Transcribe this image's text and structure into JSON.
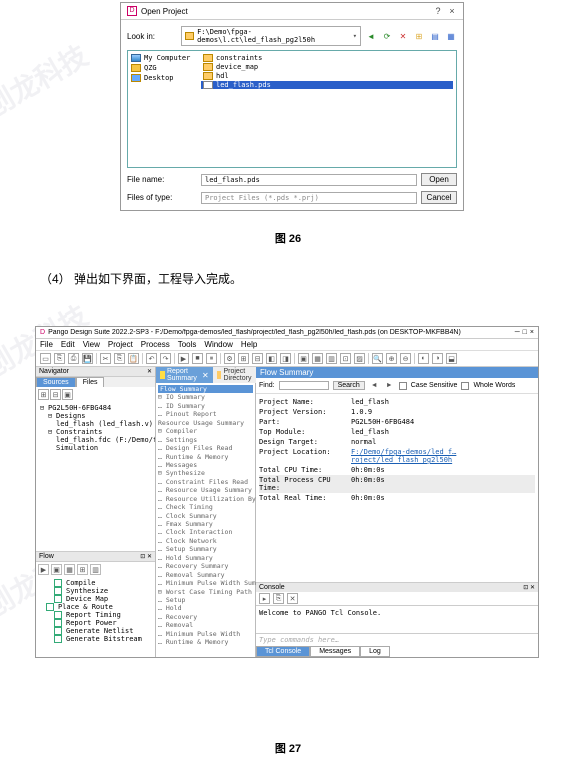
{
  "dialog": {
    "title": "Open Project",
    "help": "?",
    "close": "×",
    "look_in_label": "Look in:",
    "path_folder_icon": "folder",
    "path": "F:\\Demo\\fpga-demos\\l.ct\\led_flash_pg2l50h",
    "side": [
      {
        "icon": "computer",
        "label": "My Computer"
      },
      {
        "icon": "folder-cy",
        "label": "QZG"
      },
      {
        "icon": "folder-desk",
        "label": "Desktop"
      }
    ],
    "files": [
      {
        "icon": "folder",
        "label": "constraints"
      },
      {
        "icon": "folder",
        "label": "device_map"
      },
      {
        "icon": "folder",
        "label": "hdl"
      },
      {
        "icon": "file",
        "label": "led_flash.pds",
        "selected": true
      }
    ],
    "file_name_label": "File name:",
    "file_name": "led_flash.pds",
    "open_btn": "Open",
    "file_type_label": "Files of type:",
    "file_type": "Project Files (*.pds *.prj)",
    "cancel_btn": "Cancel"
  },
  "caption1": "图 26",
  "text1": "（4） 弹出如下界面，工程导入完成。",
  "ide": {
    "title": "Pango Design Suite 2022.2-SP3 - F:/Demo/fpga-demos/led_flash/project/led_flash_pg2l50h/led_flash.pds (on DESKTOP-MKFBB4N)",
    "wbtns": {
      "min": "─",
      "max": "□",
      "close": "×"
    },
    "menu": [
      "File",
      "Edit",
      "View",
      "Project",
      "Process",
      "Tools",
      "Window",
      "Help"
    ],
    "nav": {
      "title": "Navigator",
      "close": "✕",
      "tabs": [
        "Sources",
        "Files"
      ],
      "tree": [
        {
          "exp": "⊟",
          "ind": 0,
          "icon": "▣",
          "text": "PG2L50H-6FBG484"
        },
        {
          "exp": "⊟",
          "ind": 1,
          "icon": "",
          "text": "Designs"
        },
        {
          "exp": "",
          "ind": 2,
          "icon": "V",
          "text": "led_flash (led_flash.v)"
        },
        {
          "exp": "⊟",
          "ind": 1,
          "icon": "",
          "text": "Constraints"
        },
        {
          "exp": "",
          "ind": 2,
          "icon": "",
          "text": "led_flash.fdc (F:/Demo/fpg…"
        },
        {
          "exp": "",
          "ind": 1,
          "icon": "",
          "text": "Simulation"
        }
      ]
    },
    "flow_panel": {
      "title": "Flow",
      "items": [
        {
          "ind": 1,
          "text": "Compile"
        },
        {
          "ind": 1,
          "text": "Synthesize"
        },
        {
          "ind": 1,
          "text": "Device Map"
        },
        {
          "ind": 0,
          "text": "Place & Route"
        },
        {
          "ind": 1,
          "text": "Report Timing"
        },
        {
          "ind": 1,
          "text": "Report Power"
        },
        {
          "ind": 1,
          "text": "Generate Netlist"
        },
        {
          "ind": 1,
          "text": "Generate Bitstream"
        }
      ]
    },
    "center_tabs": [
      {
        "label": "Report Summary",
        "close": "✕"
      },
      {
        "label": "Project Directory"
      }
    ],
    "report_tree": {
      "header": "Flow Summary",
      "rows": [
        "⊟ IO Summary",
        "  … ID Summary",
        "  … Pinout Report",
        "  Resource Usage Summary",
        "⊟ Compiler",
        "  … Settings",
        "  … Design Files Read",
        "  … Runtime & Memory",
        "  … Messages",
        "⊟ Synthesize",
        "  … Constraint Files Read",
        "  … Resource Usage Summary",
        "  … Resource Utilization By Ent…",
        "  … Check Timing",
        "  … Clock Summary",
        "  … Fmax Summary",
        "  … Clock Interaction",
        "  … Clock Network",
        "  … Setup Summary",
        "  … Hold Summary",
        "  … Recovery Summary",
        "  … Removal Summary",
        "  … Minimum Pulse Width Summary",
        "⊟ Worst Case Timing Path",
        "  … Setup",
        "  … Hold",
        "  … Recovery",
        "  … Removal",
        "  … Minimum Pulse Width",
        "  … Runtime & Memory"
      ]
    },
    "summary": {
      "header": "Flow Summary",
      "find_label": "Find:",
      "search_btn": "Search",
      "case_label": "Case Sensitive",
      "whole_label": "Whole Words",
      "rows": [
        {
          "k": "Project Name:",
          "v": "led_flash"
        },
        {
          "k": "Project Version:",
          "v": "1.0.9"
        },
        {
          "k": "Part:",
          "v": "PG2L50H-6FBG484"
        },
        {
          "k": "Top Module:",
          "v": "led_flash"
        },
        {
          "k": "Design Target:",
          "v": "normal"
        },
        {
          "k": "Project Location:",
          "v": "F:/Demo/fpga-demos/led_f…roject/led_flash_pg2l50h",
          "link": true
        },
        {
          "k": "Total CPU Time:",
          "v": "0h:0m:0s"
        },
        {
          "k": "Total Process CPU Time:",
          "v": "0h:0m:0s",
          "gray": true
        },
        {
          "k": "Total Real Time:",
          "v": "0h:0m:0s"
        }
      ]
    },
    "console": {
      "title": "Console",
      "close": "✕",
      "welcome": "Welcome to PANGO Tcl Console.",
      "prompt": "Type commands here…",
      "tabs": [
        "Tcl Console",
        "Messages",
        "Log"
      ]
    }
  },
  "caption2": "图 27"
}
